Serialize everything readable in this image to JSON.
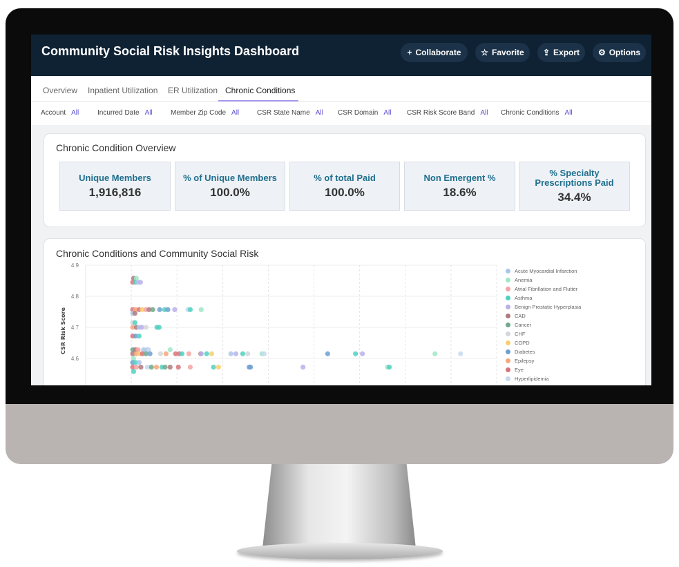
{
  "header": {
    "title": "Community Social Risk Insights Dashboard",
    "buttons": [
      {
        "label": "Collaborate",
        "icon": "plus-icon"
      },
      {
        "label": "Favorite",
        "icon": "star-icon"
      },
      {
        "label": "Export",
        "icon": "upload-icon"
      },
      {
        "label": "Options",
        "icon": "gear-icon"
      }
    ]
  },
  "tabs": [
    {
      "label": "Overview"
    },
    {
      "label": "Inpatient Utilization"
    },
    {
      "label": "ER Utilization"
    },
    {
      "label": "Chronic Conditions",
      "active": true
    }
  ],
  "filters": [
    {
      "label": "Account",
      "value": "All"
    },
    {
      "label": "Incurred Date",
      "value": "All"
    },
    {
      "label": "Member Zip Code",
      "value": "All"
    },
    {
      "label": "CSR State Name",
      "value": "All"
    },
    {
      "label": "CSR Domain",
      "value": "All"
    },
    {
      "label": "CSR Risk Score Band",
      "value": "All"
    },
    {
      "label": "Chronic Conditions",
      "value": "All"
    }
  ],
  "overview": {
    "title": "Chronic Condition Overview",
    "kpis": [
      {
        "label": "Unique Members",
        "value": "1,916,816"
      },
      {
        "label": "% of Unique Members",
        "value": "100.0%"
      },
      {
        "label": "% of total Paid",
        "value": "100.0%"
      },
      {
        "label": "Non Emergent %",
        "value": "18.6%"
      },
      {
        "label": "% Specialty Prescriptions Paid",
        "value": "34.4%"
      }
    ]
  },
  "chart_section": {
    "title": "Chronic Conditions and Community Social Risk"
  },
  "chart_data": {
    "type": "scatter",
    "ylabel": "CSR Risk Score",
    "yticks": [
      "4.9",
      "4.8",
      "4.7",
      "4.6"
    ],
    "ylim": [
      4.52,
      4.9
    ],
    "xlim": [
      0,
      9
    ],
    "grid": true,
    "legend": "right",
    "series": [
      {
        "name": "Acute Myocardial Infarction",
        "color": "#a9c6ea"
      },
      {
        "name": "Anemia",
        "color": "#9fe6c8"
      },
      {
        "name": "Atrial Fibrillation and Flutter",
        "color": "#f4a3a3"
      },
      {
        "name": "Asthma",
        "color": "#4fd1c0"
      },
      {
        "name": "Benign Prostatic Hyperplasia",
        "color": "#b9b0ea"
      },
      {
        "name": "CAD",
        "color": "#b07a7e"
      },
      {
        "name": "Cancer",
        "color": "#6fa88a"
      },
      {
        "name": "CHF",
        "color": "#d3d6da"
      },
      {
        "name": "COPD",
        "color": "#f9cf6e"
      },
      {
        "name": "Diabetes",
        "color": "#6e9fd0"
      },
      {
        "name": "Epilepsy",
        "color": "#f4a77a"
      },
      {
        "name": "Eye",
        "color": "#d9737a"
      },
      {
        "name": "Hyperlipidemia",
        "color": "#c5d9f0"
      }
    ],
    "points": [
      [
        5,
        1.05,
        4.858
      ],
      [
        1,
        1.11,
        4.858
      ],
      [
        11,
        1.03,
        4.845
      ],
      [
        3,
        1.09,
        4.845
      ],
      [
        0,
        1.14,
        4.845
      ],
      [
        4,
        1.2,
        4.845
      ],
      [
        11,
        1.03,
        4.757
      ],
      [
        10,
        1.09,
        4.757
      ],
      [
        11,
        1.17,
        4.757
      ],
      [
        8,
        1.24,
        4.757
      ],
      [
        2,
        1.32,
        4.757
      ],
      [
        5,
        1.39,
        4.757
      ],
      [
        6,
        1.47,
        4.757
      ],
      [
        9,
        1.62,
        4.757
      ],
      [
        3,
        1.73,
        4.757
      ],
      [
        9,
        1.8,
        4.757
      ],
      [
        4,
        1.95,
        4.757
      ],
      [
        12,
        2.24,
        4.757
      ],
      [
        3,
        2.29,
        4.757
      ],
      [
        1,
        2.53,
        4.757
      ],
      [
        0,
        1.03,
        4.745
      ],
      [
        5,
        1.08,
        4.745
      ],
      [
        7,
        1.03,
        4.715
      ],
      [
        3,
        1.08,
        4.715
      ],
      [
        10,
        1.03,
        4.7
      ],
      [
        5,
        1.11,
        4.7
      ],
      [
        0,
        1.17,
        4.7
      ],
      [
        4,
        1.23,
        4.7
      ],
      [
        7,
        1.32,
        4.7
      ],
      [
        3,
        1.56,
        4.7
      ],
      [
        3,
        1.61,
        4.7
      ],
      [
        11,
        1.03,
        4.672
      ],
      [
        9,
        1.09,
        4.672
      ],
      [
        3,
        1.17,
        4.672
      ],
      [
        6,
        1.03,
        4.628
      ],
      [
        5,
        1.09,
        4.628
      ],
      [
        2,
        1.15,
        4.628
      ],
      [
        0,
        1.27,
        4.628
      ],
      [
        0,
        1.35,
        4.628
      ],
      [
        12,
        1.38,
        4.628
      ],
      [
        1,
        1.85,
        4.628
      ],
      [
        5,
        1.03,
        4.615
      ],
      [
        10,
        1.11,
        4.615
      ],
      [
        8,
        1.18,
        4.615
      ],
      [
        11,
        1.24,
        4.615
      ],
      [
        6,
        1.32,
        4.615
      ],
      [
        9,
        1.41,
        4.615
      ],
      [
        7,
        1.64,
        4.615
      ],
      [
        10,
        1.76,
        4.615
      ],
      [
        11,
        1.97,
        4.615
      ],
      [
        11,
        2.05,
        4.615
      ],
      [
        3,
        2.11,
        4.615
      ],
      [
        2,
        2.26,
        4.615
      ],
      [
        5,
        2.52,
        4.615
      ],
      [
        4,
        2.53,
        4.615
      ],
      [
        3,
        2.65,
        4.615
      ],
      [
        8,
        2.76,
        4.615
      ],
      [
        0,
        3.18,
        4.615
      ],
      [
        4,
        3.29,
        4.615
      ],
      [
        3,
        3.44,
        4.615
      ],
      [
        7,
        3.55,
        4.615
      ],
      [
        1,
        3.86,
        4.615
      ],
      [
        12,
        3.91,
        4.615
      ],
      [
        9,
        5.3,
        4.615
      ],
      [
        3,
        5.91,
        4.615
      ],
      [
        4,
        6.06,
        4.615
      ],
      [
        1,
        7.65,
        4.615
      ],
      [
        12,
        8.21,
        4.615
      ],
      [
        1,
        1.05,
        4.6
      ],
      [
        9,
        1.03,
        4.587
      ],
      [
        3,
        1.09,
        4.587
      ],
      [
        0,
        1.17,
        4.587
      ],
      [
        11,
        1.03,
        4.572
      ],
      [
        2,
        1.11,
        4.572
      ],
      [
        5,
        1.21,
        4.572
      ],
      [
        12,
        1.35,
        4.572
      ],
      [
        6,
        1.44,
        4.572
      ],
      [
        10,
        1.55,
        4.572
      ],
      [
        3,
        1.67,
        4.572
      ],
      [
        6,
        1.74,
        4.572
      ],
      [
        5,
        1.85,
        4.572
      ],
      [
        11,
        2.03,
        4.572
      ],
      [
        2,
        2.29,
        4.572
      ],
      [
        3,
        2.8,
        4.572
      ],
      [
        8,
        2.91,
        4.572
      ],
      [
        9,
        3.58,
        4.572
      ],
      [
        9,
        3.61,
        4.572
      ],
      [
        4,
        4.76,
        4.572
      ],
      [
        1,
        6.61,
        4.572
      ],
      [
        3,
        6.65,
        4.572
      ],
      [
        3,
        1.05,
        4.558
      ]
    ]
  }
}
